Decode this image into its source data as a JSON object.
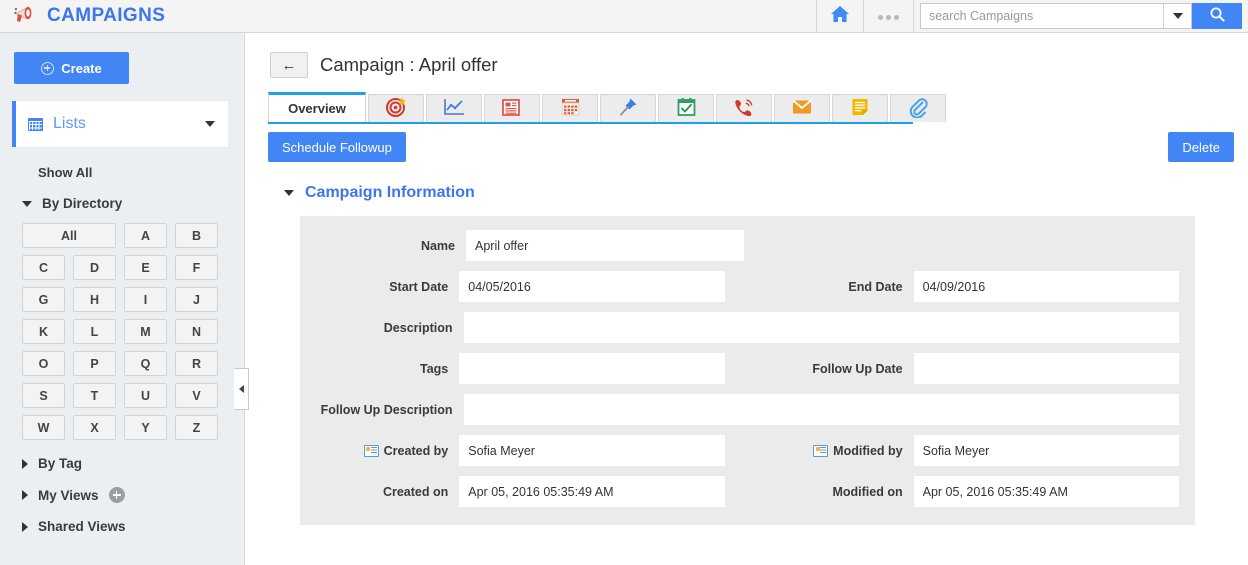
{
  "topbar": {
    "brand": "CAMPAIGNS",
    "brand_icon": "megaphone-icon",
    "home_icon": "home-icon",
    "more_icon": "more-dots-icon",
    "search_placeholder": "search Campaigns",
    "search_value": "",
    "search_icon": "magnifier-icon",
    "caret_icon": "chevron-down-icon",
    "brand_color": "#3b76ef",
    "accent_color": "#4285f4"
  },
  "sidebar": {
    "create_label": "Create",
    "create_icon": "plus-circle-icon",
    "lists_label": "Lists",
    "lists_icon": "grid-icon",
    "show_all_label": "Show All",
    "groups": [
      {
        "label": "By Directory",
        "expanded": true,
        "icon": "chevron-down-icon"
      },
      {
        "label": "By Tag",
        "expanded": false,
        "icon": "chevron-right-icon"
      },
      {
        "label": "My Views",
        "expanded": false,
        "icon": "chevron-right-icon",
        "badge": "add-view-icon"
      },
      {
        "label": "Shared Views",
        "expanded": false,
        "icon": "chevron-right-icon"
      }
    ],
    "alphabet": [
      "All",
      "A",
      "B",
      "C",
      "D",
      "E",
      "F",
      "G",
      "H",
      "I",
      "J",
      "K",
      "L",
      "M",
      "N",
      "O",
      "P",
      "Q",
      "R",
      "S",
      "T",
      "U",
      "V",
      "W",
      "X",
      "Y",
      "Z"
    ],
    "collapse_icon": "chevron-left-icon"
  },
  "main": {
    "back_icon": "back-arrow-icon",
    "title": "Campaign : April offer",
    "tabs": [
      {
        "label": "Overview",
        "icon": "",
        "active": true
      },
      {
        "label": "",
        "icon": "target-icon",
        "active": false
      },
      {
        "label": "",
        "icon": "line-chart-icon",
        "active": false
      },
      {
        "label": "",
        "icon": "document-icon",
        "active": false
      },
      {
        "label": "",
        "icon": "calendar-icon",
        "active": false
      },
      {
        "label": "",
        "icon": "pushpin-icon",
        "active": false
      },
      {
        "label": "",
        "icon": "task-calendar-icon",
        "active": false
      },
      {
        "label": "",
        "icon": "phone-icon",
        "active": false
      },
      {
        "label": "",
        "icon": "envelope-icon",
        "active": false
      },
      {
        "label": "",
        "icon": "note-icon",
        "active": false
      },
      {
        "label": "",
        "icon": "paperclip-icon",
        "active": false
      }
    ],
    "schedule_followup_label": "Schedule Followup",
    "delete_label": "Delete",
    "section_title": "Campaign Information",
    "section_icon": "chevron-down-icon",
    "fields": {
      "name_label": "Name",
      "name_value": "April offer",
      "start_date_label": "Start Date",
      "start_date_value": "04/05/2016",
      "end_date_label": "End Date",
      "end_date_value": "04/09/2016",
      "description_label": "Description",
      "description_value": "",
      "tags_label": "Tags",
      "tags_value": "",
      "follow_up_date_label": "Follow Up Date",
      "follow_up_date_value": "",
      "follow_up_description_label": "Follow Up Description",
      "follow_up_description_value": "",
      "created_by_label": "Created by",
      "created_by_value": "Sofia Meyer",
      "modified_by_label": "Modified by",
      "modified_by_value": "Sofia Meyer",
      "created_on_label": "Created on",
      "created_on_value": "Apr 05, 2016 05:35:49 AM",
      "modified_on_label": "Modified on",
      "modified_on_value": "Apr 05, 2016 05:35:49 AM",
      "user_icon": "contact-card-icon"
    }
  }
}
